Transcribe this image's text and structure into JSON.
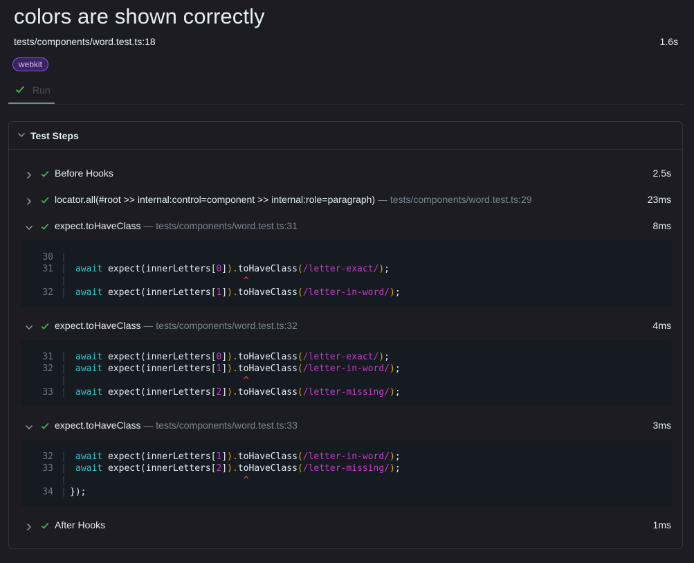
{
  "test": {
    "title": "colors are shown correctly",
    "location": "tests/components/word.test.ts:18",
    "duration": "1.6s",
    "tag": "webkit"
  },
  "tabs": [
    {
      "label": "Run"
    }
  ],
  "panel": {
    "title": "Test Steps"
  },
  "steps": [
    {
      "title": "Before Hooks",
      "location": "",
      "duration": "2.5s",
      "expanded": false
    },
    {
      "title": "locator.all(#root >> internal:control=component >> internal:role=paragraph)",
      "location": " — tests/components/word.test.ts:29",
      "duration": "23ms",
      "expanded": false
    },
    {
      "title": "expect.toHaveClass",
      "location": " — tests/components/word.test.ts:31",
      "duration": "8ms",
      "expanded": true
    },
    {
      "title": "expect.toHaveClass",
      "location": " — tests/components/word.test.ts:32",
      "duration": "4ms",
      "expanded": true
    },
    {
      "title": "expect.toHaveClass",
      "location": " — tests/components/word.test.ts:33",
      "duration": "3ms",
      "expanded": true
    },
    {
      "title": "After Hooks",
      "location": "",
      "duration": "1ms",
      "expanded": false
    }
  ],
  "snippets": [
    {
      "lines": [
        {
          "num": "30",
          "code": ""
        },
        {
          "num": "31",
          "code": "await expect(innerLetters[0]).toHaveClass(/letter-exact/);",
          "idx": "0",
          "rx": "/letter-exact/"
        },
        {
          "num": "",
          "code": "^",
          "caret": true
        },
        {
          "num": "32",
          "code": "await expect(innerLetters[1]).toHaveClass(/letter-in-word/);",
          "idx": "1",
          "rx": "/letter-in-word/"
        }
      ]
    },
    {
      "lines": [
        {
          "num": "31",
          "code": "await expect(innerLetters[0]).toHaveClass(/letter-exact/);",
          "idx": "0",
          "rx": "/letter-exact/"
        },
        {
          "num": "32",
          "code": "await expect(innerLetters[1]).toHaveClass(/letter-in-word/);",
          "idx": "1",
          "rx": "/letter-in-word/"
        },
        {
          "num": "",
          "code": "^",
          "caret": true
        },
        {
          "num": "33",
          "code": "await expect(innerLetters[2]).toHaveClass(/letter-missing/);",
          "idx": "2",
          "rx": "/letter-missing/"
        }
      ]
    },
    {
      "lines": [
        {
          "num": "32",
          "code": "await expect(innerLetters[1]).toHaveClass(/letter-in-word/);",
          "idx": "1",
          "rx": "/letter-in-word/"
        },
        {
          "num": "33",
          "code": "await expect(innerLetters[2]).toHaveClass(/letter-missing/);",
          "idx": "2",
          "rx": "/letter-missing/"
        },
        {
          "num": "",
          "code": "^",
          "caret": true
        },
        {
          "num": "34",
          "code": "});",
          "plain": true
        }
      ]
    }
  ],
  "colors": {
    "background": "#1c1c22",
    "check": "#3fb950",
    "keyword": "#2fc2c2",
    "regex": "#c23dc2",
    "paren": "#e6a600",
    "caret": "#e5534b",
    "tag_border": "#8957e5"
  }
}
